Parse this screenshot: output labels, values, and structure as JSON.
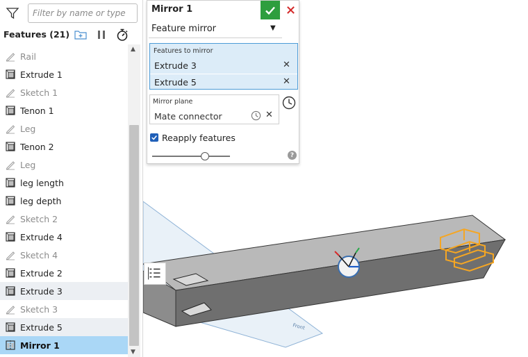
{
  "filter": {
    "placeholder": "Filter by name or type"
  },
  "features_header": {
    "title": "Features (21)"
  },
  "features": [
    {
      "label": "Rail",
      "kind": "sketch"
    },
    {
      "label": "Extrude 1",
      "kind": "part"
    },
    {
      "label": "Sketch 1",
      "kind": "sketch"
    },
    {
      "label": "Tenon 1",
      "kind": "part"
    },
    {
      "label": "Leg",
      "kind": "sketch"
    },
    {
      "label": "Tenon 2",
      "kind": "part"
    },
    {
      "label": "Leg",
      "kind": "sketch"
    },
    {
      "label": "leg length",
      "kind": "part"
    },
    {
      "label": "leg depth",
      "kind": "part"
    },
    {
      "label": "Sketch 2",
      "kind": "sketch"
    },
    {
      "label": "Extrude 4",
      "kind": "part"
    },
    {
      "label": "Sketch 4",
      "kind": "sketch"
    },
    {
      "label": "Extrude 2",
      "kind": "part"
    },
    {
      "label": "Extrude 3",
      "kind": "part",
      "state": "selected"
    },
    {
      "label": "Sketch 3",
      "kind": "sketch"
    },
    {
      "label": "Extrude 5",
      "kind": "part",
      "state": "selected"
    },
    {
      "label": "Mirror 1",
      "kind": "mirror",
      "state": "active"
    }
  ],
  "dialog": {
    "title": "Mirror 1",
    "type_value": "Feature mirror",
    "features_caption": "Features to mirror",
    "features_to_mirror": [
      "Extrude 3",
      "Extrude 5"
    ],
    "plane_caption": "Mirror plane",
    "plane_value": "Mate connector",
    "reapply_label": "Reapply features",
    "reapply_checked": true,
    "slider_level": 0.7
  },
  "colors": {
    "accent": "#2e9e3e",
    "selection_blue": "#4c9bd6",
    "active_row": "#aad7f6",
    "highlight_orange": "#f5a623",
    "cancel_red": "#d42b2b"
  },
  "icons": [
    "filter-icon",
    "add-folder-icon",
    "pause-icon",
    "timer-icon",
    "check-icon",
    "close-icon",
    "clock-icon",
    "help-icon",
    "list-icon"
  ]
}
